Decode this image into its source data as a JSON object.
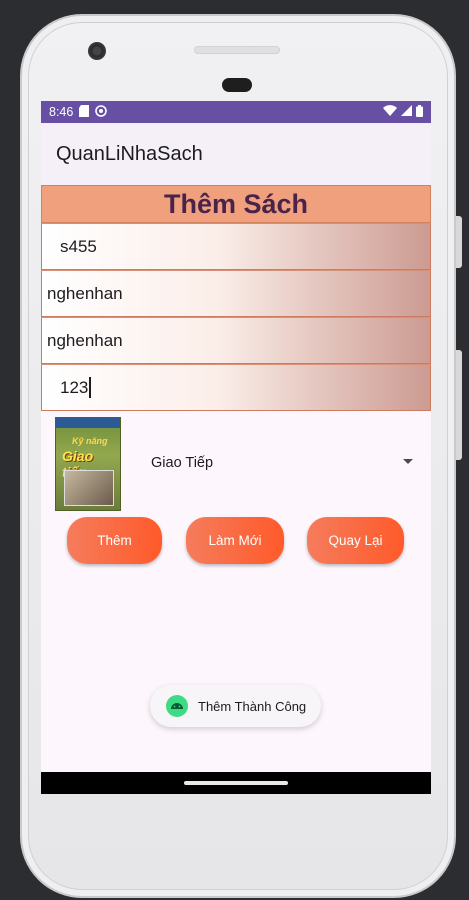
{
  "status_bar": {
    "time": "8:46"
  },
  "app_bar": {
    "title": "QuanLiNhaSach"
  },
  "form": {
    "header": "Thêm Sách",
    "fields": [
      "s455",
      "nghenhan",
      "nghenhan",
      "123"
    ]
  },
  "book": {
    "cover_icon": "book-cover-image",
    "category": "Giao Tiếp"
  },
  "buttons": {
    "add": "Thêm",
    "reset": "Làm Mới",
    "back": "Quay Lại"
  },
  "toast": {
    "message": "Thêm Thành Công"
  },
  "colors": {
    "status_bar": "#6750a4",
    "header_bg": "#f0a07c",
    "header_text": "#4a234a",
    "button": "#ff5a2a"
  }
}
